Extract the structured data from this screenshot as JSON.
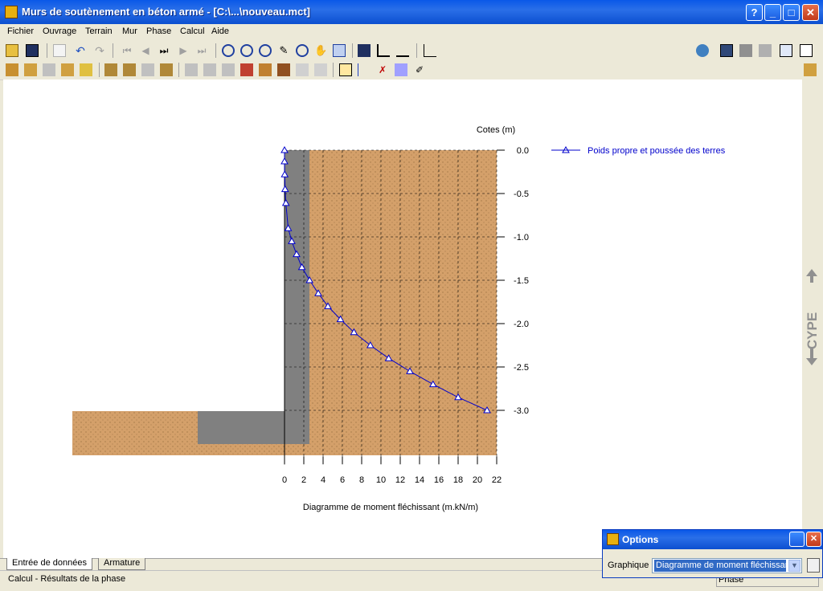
{
  "window": {
    "title": "Murs de soutènement en béton armé - [C:\\...\\nouveau.mct]",
    "buttons": {
      "help": "?",
      "minimize": "_",
      "maximize": "□",
      "close": "✕"
    }
  },
  "menu": [
    "Fichier",
    "Ouvrage",
    "Terrain",
    "Mur",
    "Phase",
    "Calcul",
    "Aide"
  ],
  "chart_data": {
    "type": "line",
    "xlabel": "Diagramme de moment fléchissant (m.kN/m)",
    "ylabel": "Cotes (m)",
    "xticks": [
      0,
      2,
      4,
      6,
      8,
      10,
      12,
      14,
      16,
      18,
      20,
      22
    ],
    "yticks": [
      "0.0",
      "-0.5",
      "-1.0",
      "-1.5",
      "-2.0",
      "-2.5",
      "-3.0"
    ],
    "xlim": [
      0,
      22
    ],
    "ylim": [
      -3.53,
      0
    ],
    "grid": true,
    "legend": {
      "position": "top-right"
    },
    "series": [
      {
        "name": "Poids propre et poussée des terres",
        "color": "#0000cc",
        "marker": "triangle",
        "points": [
          [
            0,
            0.0
          ],
          [
            0.0,
            -0.13
          ],
          [
            0.02,
            -0.28
          ],
          [
            0.06,
            -0.45
          ],
          [
            0.14,
            -0.61
          ],
          [
            0.38,
            -0.9
          ],
          [
            0.75,
            -1.05
          ],
          [
            1.25,
            -1.2
          ],
          [
            1.8,
            -1.35
          ],
          [
            2.6,
            -1.5
          ],
          [
            3.5,
            -1.65
          ],
          [
            4.5,
            -1.8
          ],
          [
            5.8,
            -1.95
          ],
          [
            7.2,
            -2.1
          ],
          [
            8.9,
            -2.25
          ],
          [
            10.8,
            -2.4
          ],
          [
            13.0,
            -2.55
          ],
          [
            15.4,
            -2.7
          ],
          [
            18.0,
            -2.85
          ],
          [
            21.0,
            -3.0
          ]
        ]
      }
    ]
  },
  "tabs": [
    "Entrée de données",
    "Armature"
  ],
  "status": {
    "text": "Calcul - Résultats de la phase",
    "phase": "Phase"
  },
  "options_panel": {
    "title": "Options",
    "graph_label": "Graphique",
    "graph_value": "Diagramme de moment fléchissant"
  },
  "brand": "CYPE",
  "colors": {
    "soil": "#d4a06a",
    "concrete": "#808080",
    "accent": "#0000cc"
  }
}
